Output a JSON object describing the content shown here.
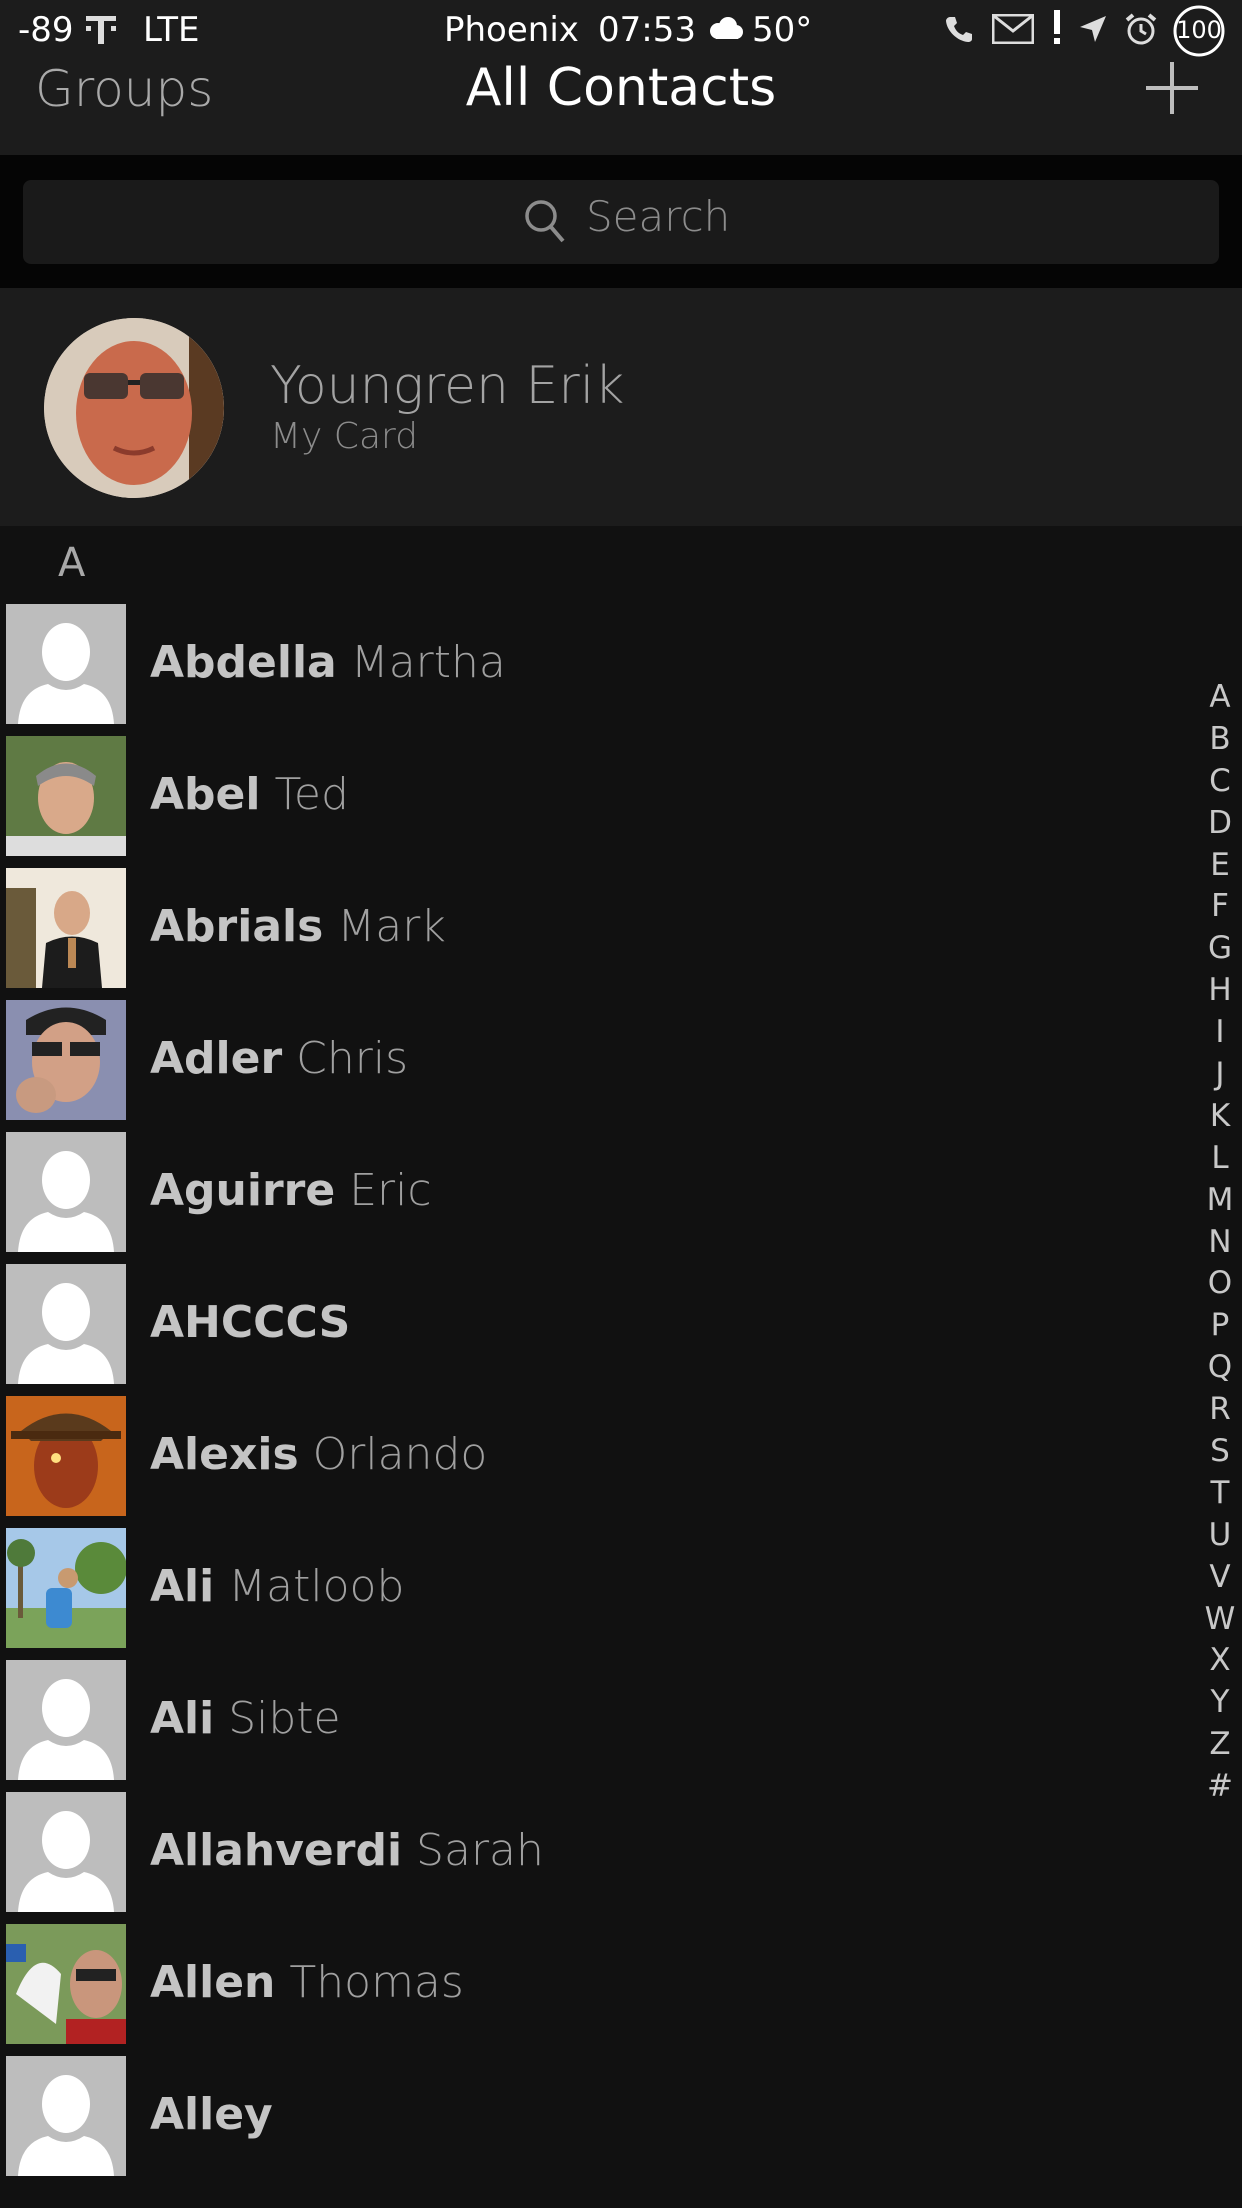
{
  "status": {
    "signal": "-89",
    "network": "LTE",
    "city": "Phoenix",
    "time": "07:53",
    "temp": "50°",
    "battery": "100"
  },
  "nav": {
    "groups": "Groups",
    "title": "All Contacts",
    "add_icon": "plus-icon"
  },
  "search": {
    "placeholder": "Search"
  },
  "my_card": {
    "name": "Youngren Erik",
    "label": "My Card"
  },
  "section_header": "A",
  "contacts": [
    {
      "last": "Abdella",
      "first": "Martha",
      "photo": "placeholder"
    },
    {
      "last": "Abel",
      "first": "Ted",
      "photo": "photo"
    },
    {
      "last": "Abrials",
      "first": "Mark",
      "photo": "photo"
    },
    {
      "last": "Adler",
      "first": "Chris",
      "photo": "photo"
    },
    {
      "last": "Aguirre",
      "first": "Eric",
      "photo": "placeholder"
    },
    {
      "last": "AHCCCS",
      "first": "",
      "photo": "placeholder"
    },
    {
      "last": "Alexis",
      "first": "Orlando",
      "photo": "photo"
    },
    {
      "last": "Ali",
      "first": "Matloob",
      "photo": "photo"
    },
    {
      "last": "Ali",
      "first": "Sibte",
      "photo": "placeholder"
    },
    {
      "last": "Allahverdi",
      "first": "Sarah",
      "photo": "placeholder"
    },
    {
      "last": "Allen",
      "first": "Thomas",
      "photo": "photo"
    },
    {
      "last": "Alley",
      "first": "",
      "photo": "placeholder"
    }
  ],
  "index_letters": [
    "A",
    "B",
    "C",
    "D",
    "E",
    "F",
    "G",
    "H",
    "I",
    "J",
    "K",
    "L",
    "M",
    "N",
    "O",
    "P",
    "Q",
    "R",
    "S",
    "T",
    "U",
    "V",
    "W",
    "X",
    "Y",
    "Z",
    "#"
  ],
  "colors": {
    "background": "#111111",
    "bar": "#1c1c1c",
    "text": "#bdbdbd",
    "accent": "#ffffff"
  }
}
